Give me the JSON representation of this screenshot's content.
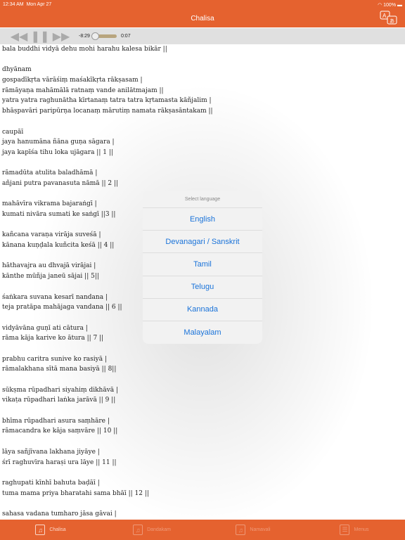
{
  "status": {
    "time": "12:34 AM",
    "date": "Mon Apr 27",
    "battery": "100%"
  },
  "nav": {
    "title": "Chalisa",
    "translate_icon": "translate-icon"
  },
  "player": {
    "elapsed_remaining": "-8:29",
    "current": "0:07",
    "progress": 0.014
  },
  "text_lines": [
    "bala buddhi vidyā dehu mohi harahu kalesa bikār ||",
    "",
    "dhyānam",
    "gospadīkṛta vārāśiṃ maśakīkṛta rākṣasam |",
    "rāmāyaṇa mahāmālā ratnaṃ vande anilātmajam ||",
    "yatra yatra raghunātha kīrtanaṃ tatra tatra kṛtamasta kāñjalim |",
    "bhāṣpavāri paripūrṇa locanaṃ mārutiṃ namata rākṣasāntakam ||",
    "",
    "caupāī",
    "jaya hanumāna ñāna guṇa sāgara |",
    "jaya kapīśa tihu loka ujāgara || 1 ||",
    "",
    "rāmadūta atulita baladhāmā |",
    "añjani putra pavanasuta nāmā || 2 ||",
    "",
    "mahāvīra vikrama bajaraṅgī |",
    "kumati nivāra sumati ke saṅgī ||3 ||",
    "",
    "kañcana varaṇa virāja suveśā |",
    "kānana kuṇḍala kuñcita keśā || 4 ||",
    "",
    "hāthavajra au dhvajā virājai |",
    "kānthe mūñja janeū sājai || 5||",
    "",
    "śaṅkara suvana kesarī nandana |",
    "teja pratāpa mahājaga vandana || 6 ||",
    "",
    "vidyāvāna guṇī ati cātura |",
    "rāma kāja karive ko ātura || 7 ||",
    "",
    "prabhu caritra sunive ko rasiyā |",
    "rāmalakhana sītā mana basiyā || 8||",
    "",
    "sūkṣma rūpadhari siyahiṃ dikhāvā |",
    "vikaṭa rūpadhari laṅka jarāvā || 9 ||",
    "",
    "bhīma rūpadhari asura saṃhāre |",
    "rāmacandra ke kāja saṃvāre || 10 ||",
    "",
    "lāya sañjīvana lakhana jiyāye |",
    "śrī raghuvīra haraṣi ura lāye || 11 ||",
    "",
    "raghupati kīnhī bahuta baḍāī |",
    "tuma mama priya bharatahi sama bhāī || 12 ||",
    "",
    "sahasa vadana tumharo jāsa gāvai |"
  ],
  "language_popup": {
    "title": "Select language",
    "options": [
      "English",
      "Devanagari / Sanskrit",
      "Tamil",
      "Telugu",
      "Kannada",
      "Malayalam"
    ]
  },
  "tabs": [
    {
      "label": "Chalisa",
      "active": true
    },
    {
      "label": "Dandakam"
    },
    {
      "label": "Namavali"
    },
    {
      "label": "Menus"
    }
  ],
  "colors": {
    "brand": "#e5622f",
    "link": "#1a73d9"
  }
}
